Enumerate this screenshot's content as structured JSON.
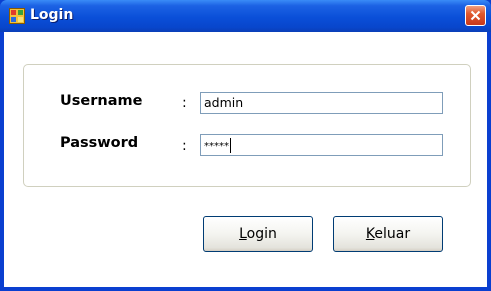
{
  "window": {
    "title": "Login",
    "icon": "app-window-icon",
    "close_icon": "close-icon",
    "titlebar_color": "#0a4fd8",
    "close_color": "#e0582e"
  },
  "form": {
    "username_label": "Username",
    "password_label": "Password",
    "colon": ":",
    "username_value": "admin",
    "password_value": "*****"
  },
  "buttons": {
    "login_first": "L",
    "login_rest": "ogin",
    "keluar_first": "K",
    "keluar_rest": "eluar"
  }
}
